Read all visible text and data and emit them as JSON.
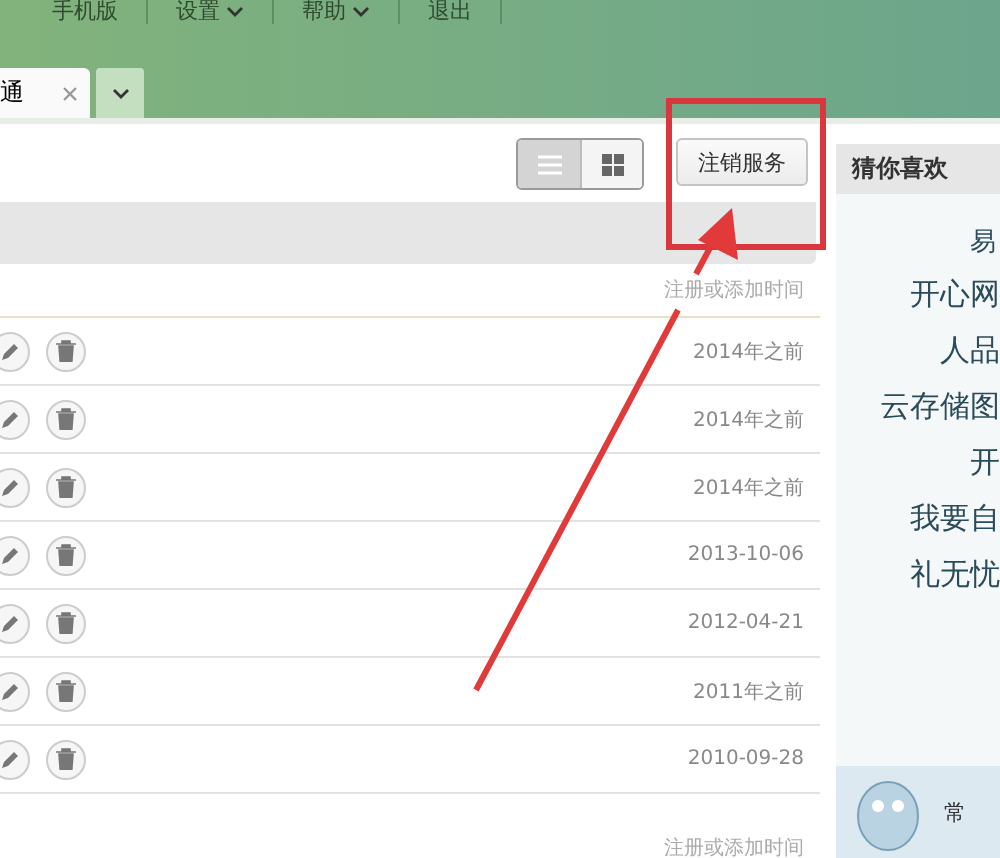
{
  "top_menu": [
    {
      "label": "手机版",
      "dropdown": false
    },
    {
      "label": "设置",
      "dropdown": true
    },
    {
      "label": "帮助",
      "dropdown": true
    },
    {
      "label": "退出",
      "dropdown": false
    }
  ],
  "tabs": [
    {
      "label": "通",
      "selected": true
    }
  ],
  "toolbar": {
    "views": [
      {
        "kind": "list",
        "selected": true
      },
      {
        "kind": "grid",
        "selected": false
      }
    ],
    "button": "注销服务"
  },
  "table": {
    "column_header": "注册或添加时间",
    "rows": [
      {
        "date": "2014年之前"
      },
      {
        "date": "2014年之前"
      },
      {
        "date": "2014年之前"
      },
      {
        "date": "2013-10-06"
      },
      {
        "date": "2012-04-21"
      },
      {
        "date": "2011年之前"
      },
      {
        "date": "2010-09-28"
      }
    ],
    "footer": "注册或添加时间"
  },
  "sidebar": {
    "title": "猜你喜欢",
    "items": [
      {
        "text": "易",
        "kind": "small"
      },
      {
        "text": "开心网",
        "kind": "large"
      },
      {
        "text": "人品",
        "kind": "large"
      },
      {
        "text": "云存储图",
        "kind": "large"
      },
      {
        "text": "开",
        "kind": "large"
      },
      {
        "text": "我要自",
        "kind": "large"
      },
      {
        "text": "礼无忧",
        "kind": "large"
      }
    ],
    "promo": "常"
  }
}
